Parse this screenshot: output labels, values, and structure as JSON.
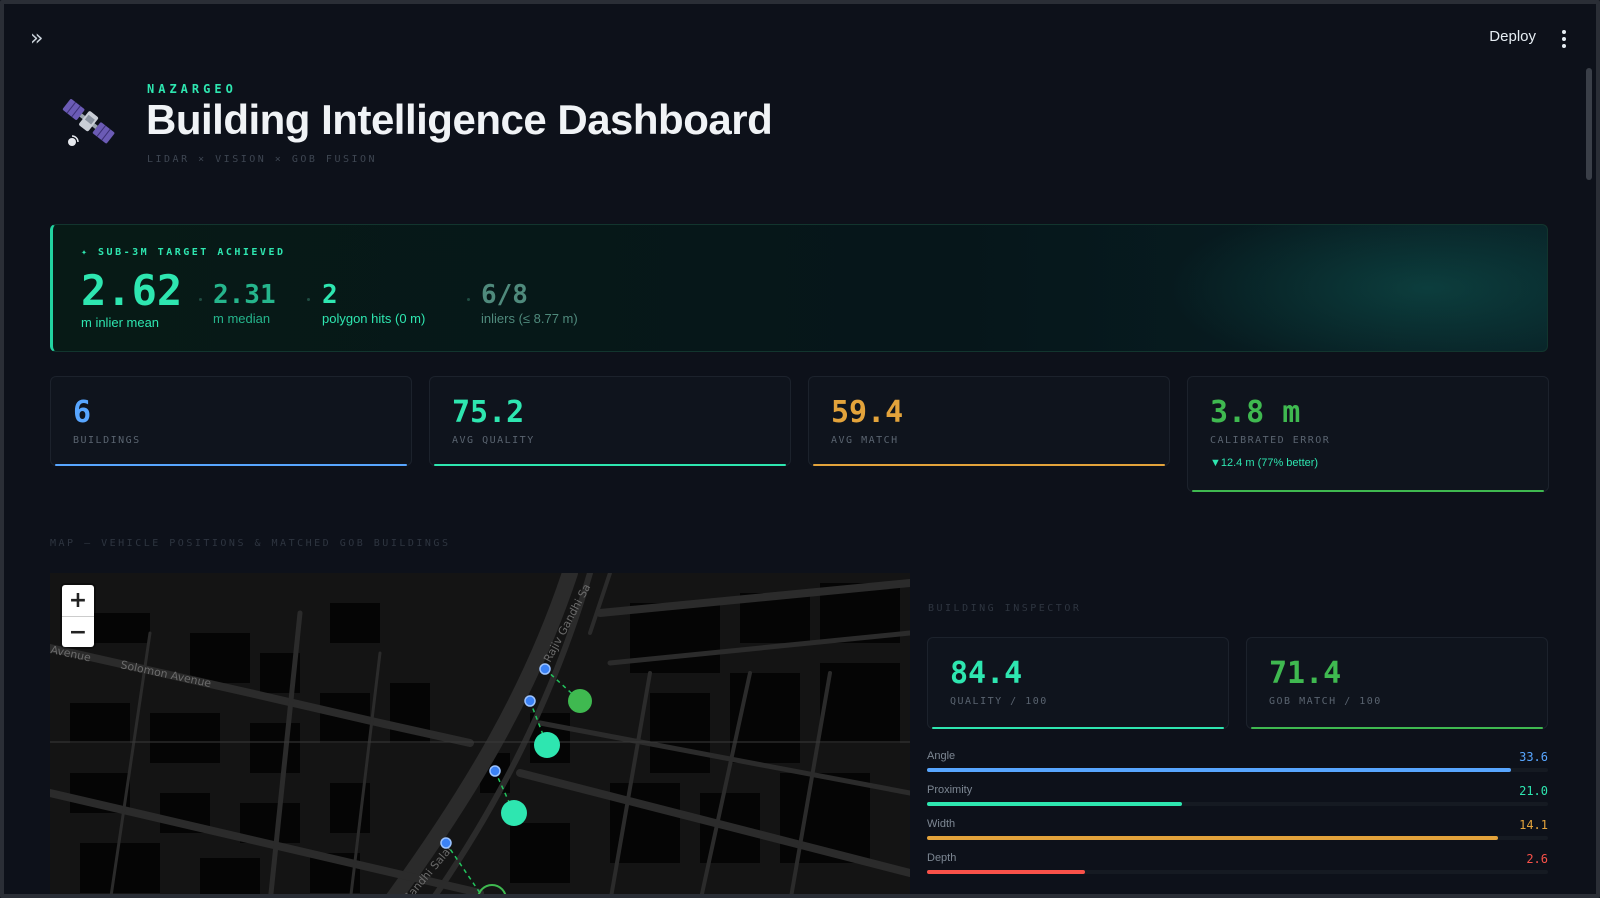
{
  "topbar": {
    "deploy_label": "Deploy",
    "sidebar_toggle_icon": "double-chevron-right-icon",
    "menu_icon": "vertical-dots-icon"
  },
  "header": {
    "logo_icon": "satellite-icon",
    "brand": "NAZARGEO",
    "title": "Building Intelligence Dashboard",
    "subtitle": "LIDAR × VISION × GOB FUSION"
  },
  "banner": {
    "badge": "✦ SUB-3M TARGET ACHIEVED",
    "stats": [
      {
        "value": "2.62",
        "label": "m inlier mean"
      },
      {
        "value": "2.31",
        "label": "m median"
      },
      {
        "value": "2",
        "label": "polygon hits (0 m)"
      },
      {
        "value": "6/8",
        "label": "inliers (≤ 8.77 m)"
      }
    ]
  },
  "cards": [
    {
      "value": "6",
      "label": "BUILDINGS",
      "color": "#58a6ff"
    },
    {
      "value": "75.2",
      "label": "AVG QUALITY",
      "color": "#2ee6b0"
    },
    {
      "value": "59.4",
      "label": "AVG MATCH",
      "color": "#e3a33b"
    },
    {
      "value": "3.8 m",
      "label": "CALIBRATED ERROR",
      "color": "#3fb950",
      "delta": "▼12.4 m (77% better)"
    }
  ],
  "map_section": {
    "label": "MAP — VEHICLE POSITIONS & MATCHED GOB BUILDINGS",
    "zoom_in": "+",
    "zoom_out": "−",
    "street_labels": [
      "Avenue",
      "Solomon Avenue",
      "Rajiv Gandhi Sa",
      "Gandhi Salai"
    ]
  },
  "inspector": {
    "label": "BUILDING INSPECTOR",
    "quality": {
      "value": "84.4",
      "label": "QUALITY / 100",
      "color": "#2ee6b0"
    },
    "match": {
      "value": "71.4",
      "label": "GOB MATCH / 100",
      "color": "#3fb950"
    },
    "metrics": [
      {
        "name": "Angle",
        "value": "33.6",
        "fraction": 0.94,
        "color": "#58a6ff"
      },
      {
        "name": "Proximity",
        "value": "21.0",
        "fraction": 0.41,
        "color": "#2ee6b0"
      },
      {
        "name": "Width",
        "value": "14.1",
        "fraction": 0.92,
        "color": "#e3a33b"
      },
      {
        "name": "Depth",
        "value": "2.6",
        "fraction": 0.255,
        "color": "#f85149"
      }
    ]
  }
}
